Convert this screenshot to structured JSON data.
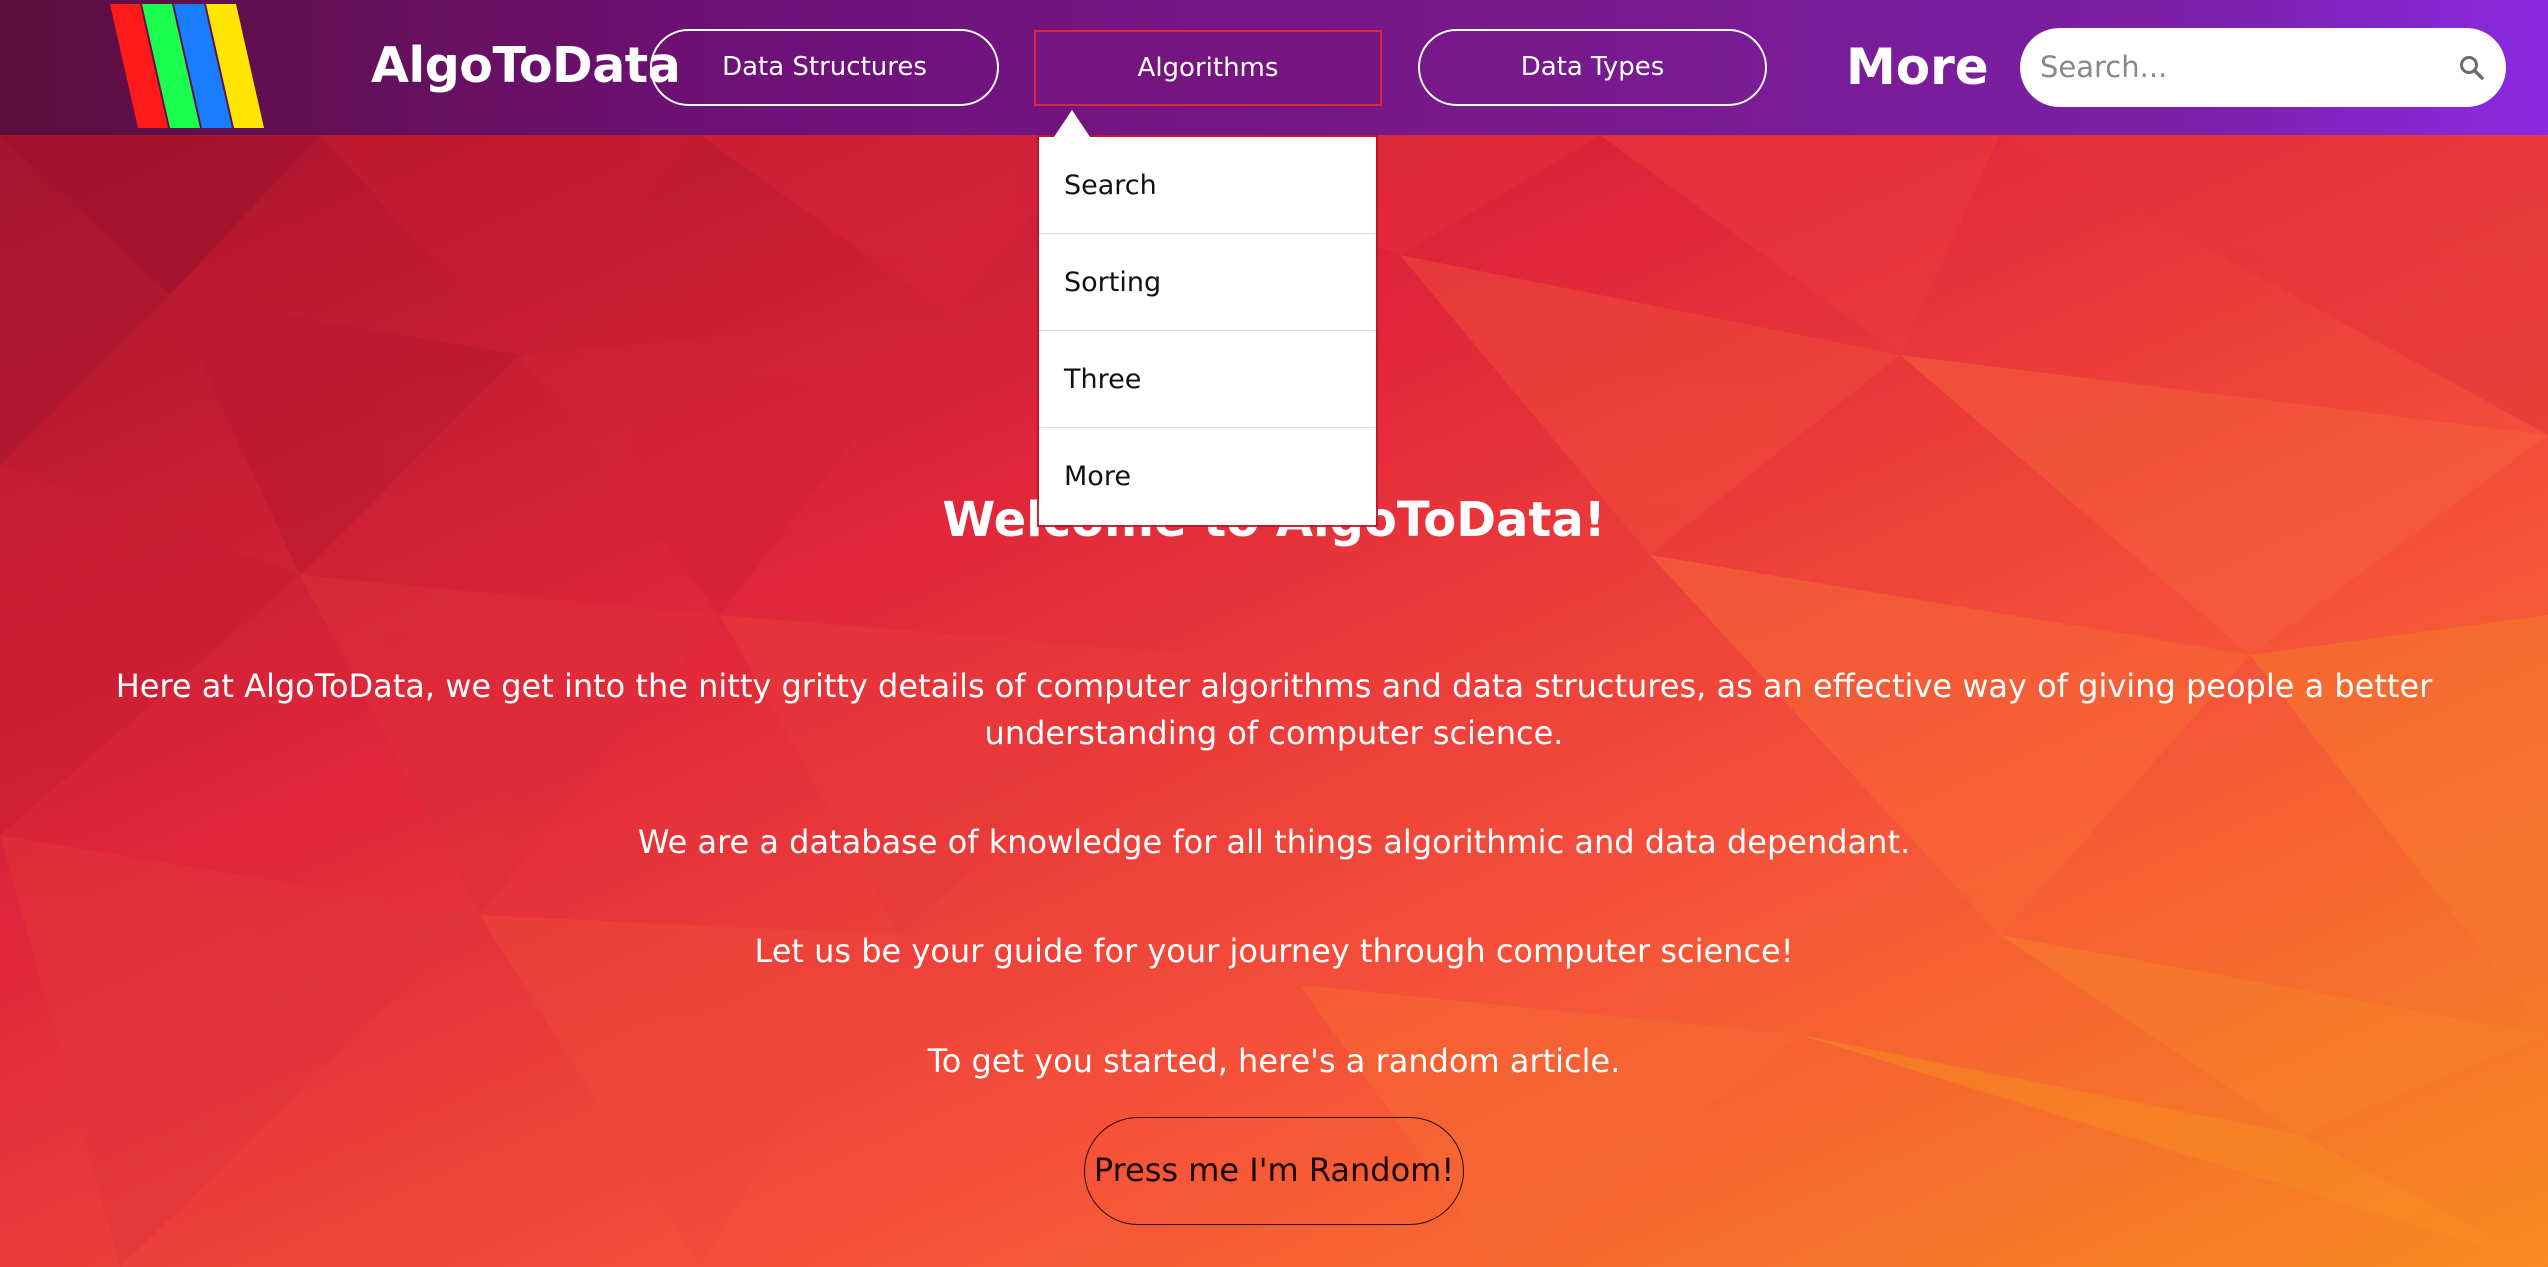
{
  "header": {
    "brand": "AlgoToData",
    "nav": [
      {
        "label": "Data Structures"
      },
      {
        "label": "Algorithms"
      },
      {
        "label": "Data Types"
      }
    ],
    "more_label": "More",
    "search": {
      "placeholder": "Search..."
    }
  },
  "dropdown": {
    "items": [
      {
        "label": "Search"
      },
      {
        "label": "Sorting"
      },
      {
        "label": "Three"
      },
      {
        "label": "More"
      }
    ]
  },
  "hero": {
    "welcome": "Welcome to AlgoToData!",
    "paragraphs": [
      "Here at AlgoToData, we get into the nitty gritty details of computer algorithms and data structures, as an effective way of giving people a better understanding of computer science.",
      "We are a database of knowledge for all things algorithmic and data dependant.",
      "Let us be your guide for your journey through computer science!",
      "To get you started, here's a random article."
    ],
    "random_button": "Press me I'm Random!"
  },
  "colors": {
    "nav_gradient_start": "#5c0e3d",
    "nav_gradient_end": "#8a2be2",
    "hero_red": "#e0263a",
    "hero_orange": "#f78a20",
    "logo_stripes": [
      "#ff1a1a",
      "#1aff4d",
      "#1a7cff",
      "#ffe600"
    ]
  },
  "icons": {
    "logo": "rainbow-stripes-logo",
    "search": "search-icon"
  }
}
